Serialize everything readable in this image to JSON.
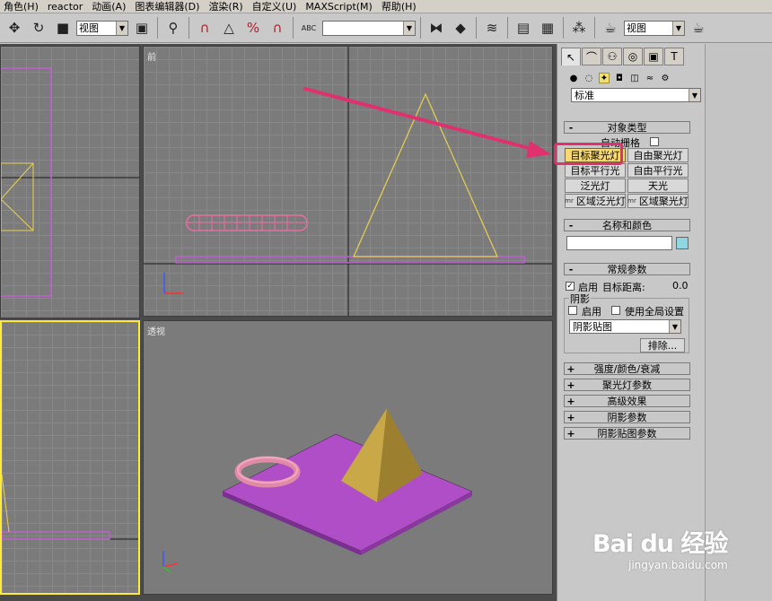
{
  "menu": [
    "角色(H)",
    "reactor",
    "动画(A)",
    "图表编辑器(D)",
    "渲染(R)",
    "自定义(U)",
    "MAXScript(M)",
    "帮助(H)"
  ],
  "toolbar": {
    "view_select": "视图",
    "view_select_right": "视图",
    "abc_label": "ABC"
  },
  "viewports": {
    "front_label": "前",
    "perspective_label": "透视"
  },
  "command_panel": {
    "category_dropdown": "标准",
    "rollout_object_type": {
      "title": "对象类型",
      "sign": "-",
      "auto_grid": "自动栅格",
      "buttons": [
        {
          "label": "目标聚光灯",
          "mr": "",
          "selected": true
        },
        {
          "label": "自由聚光灯",
          "mr": "",
          "selected": false
        },
        {
          "label": "目标平行光",
          "mr": "",
          "selected": false
        },
        {
          "label": "自由平行光",
          "mr": "",
          "selected": false
        },
        {
          "label": "泛光灯",
          "mr": "",
          "selected": false
        },
        {
          "label": "天光",
          "mr": "",
          "selected": false
        },
        {
          "label": "区域泛光灯",
          "mr": "mr",
          "selected": false
        },
        {
          "label": "区域聚光灯",
          "mr": "mr",
          "selected": false
        }
      ]
    },
    "rollout_name_color": {
      "title": "名称和颜色",
      "sign": "-",
      "name_value": "",
      "swatch_color": "#8ed6e0"
    },
    "rollout_general": {
      "title": "常规参数",
      "sign": "-",
      "enable_label": "启用",
      "enable_checked": "✓",
      "target_distance_label": "目标距离:",
      "target_distance_value": "0.0",
      "shadow_group": "阴影",
      "shadow_enable": "启用",
      "global_settings": "使用全局设置",
      "shadow_type": "阴影贴图",
      "exclude_button": "排除..."
    },
    "collapsed_rollouts": [
      {
        "sign": "+",
        "title": "强度/颜色/衰减"
      },
      {
        "sign": "+",
        "title": "聚光灯参数"
      },
      {
        "sign": "+",
        "title": "高级效果"
      },
      {
        "sign": "+",
        "title": "阴影参数"
      },
      {
        "sign": "+",
        "title": "阴影贴图参数"
      }
    ]
  },
  "watermark": {
    "logo": "Bai du 经验",
    "url": "jingyan.baidu.com"
  },
  "colors": {
    "accent_pink": "#e0306e",
    "plane_purple": "#b04ec8",
    "pyramid_gold": "#c9a947",
    "torus_pink": "#e08aa8",
    "selection_yellow": "#ffeb3b"
  }
}
